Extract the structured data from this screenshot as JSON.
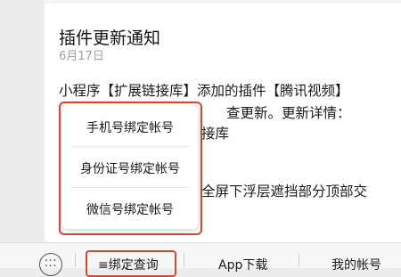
{
  "message": {
    "title": "插件更新通知",
    "date": "6月17日",
    "line1": "小程序【扩展链接库】添加的插件【腾讯视频】",
    "line2": "查更新。更新详情：",
    "line3": "接库",
    "line5": "全屏下浮层遮挡部分顶部交"
  },
  "popup": {
    "items": [
      "手机号绑定帐号",
      "身份证号绑定帐号",
      "微信号绑定帐号"
    ]
  },
  "tabbar": {
    "tab1": "≡绑定查询",
    "tab2": "App下载",
    "tab3": "我的帐号"
  },
  "colors": {
    "highlight": "#d8462e",
    "background": "#ededed"
  }
}
